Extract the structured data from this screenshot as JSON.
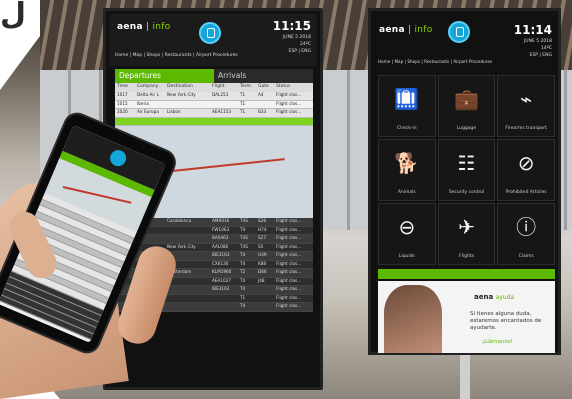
{
  "corner_glyph": "ل",
  "kiosk1": {
    "brand": "aena",
    "brand_sub": "info",
    "time": "11:15",
    "date": "JUNE 5 2018",
    "temp": "24ºC",
    "lang": "ESP | ENG",
    "nav": "Home | Map | Shops | Restaurants | Airport Procedures",
    "tabs": [
      "Departures",
      "Arrivals"
    ],
    "columns": [
      "Time",
      "Company",
      "Destination",
      "Flight",
      "Term.",
      "Gate",
      "Status"
    ],
    "rows_top": [
      [
        "1017",
        "Delta Air L",
        "New York City",
        "DAL253",
        "T1",
        "A4",
        "Flight clos..."
      ],
      [
        "1015",
        "Iberia",
        "",
        "",
        "T1",
        "",
        "Flight clos..."
      ],
      [
        "1020",
        "Air Europa",
        "Lisbon",
        "AEA1153",
        "T1",
        "B33",
        "Flight clos..."
      ]
    ],
    "rows_bottom": [
      [
        "",
        "",
        "Casablanca",
        "AMX016",
        "T4S",
        "S28",
        "Flight clos..."
      ],
      [
        "",
        "",
        "",
        "FW1063",
        "T4",
        "H74",
        "Flight clos..."
      ],
      [
        "",
        "",
        "",
        "BA0463",
        "T4S",
        "S27",
        "Flight clos..."
      ],
      [
        "",
        "",
        "New York City",
        "AAL086",
        "T4S",
        "S5",
        "Flight clos..."
      ],
      [
        "",
        "",
        "",
        "IBE3163",
        "T4",
        "H39",
        "Flight clos..."
      ],
      [
        "",
        "",
        "",
        "CX6130",
        "T4",
        "K88",
        "Flight clos..."
      ],
      [
        "",
        "",
        "Amsterdam",
        "KLM1960",
        "T2",
        "D66",
        "Flight clos..."
      ],
      [
        "",
        "",
        "",
        "AEA1027",
        "T4",
        "J48",
        "Flight clos..."
      ],
      [
        "",
        "",
        "",
        "IBE3162",
        "T4",
        "",
        "Flight clos..."
      ],
      [
        "",
        "",
        "",
        "",
        "T1",
        "",
        "Flight clos..."
      ],
      [
        "",
        "",
        "",
        "",
        "T4",
        "",
        "Flight clos..."
      ]
    ]
  },
  "kiosk2": {
    "brand": "aena",
    "brand_sub": "info",
    "time": "11:14",
    "date": "JUNE 5 2018",
    "temp": "14ºC",
    "lang": "ESP | ENG",
    "nav": "Home | Map | Shops | Restaurants | Airport Procedures",
    "tiles": [
      {
        "icon": "luggage-cart-icon",
        "glyph": "🛄",
        "label": "Check-in"
      },
      {
        "icon": "luggage-icon",
        "glyph": "💼",
        "label": "Luggage"
      },
      {
        "icon": "gun-icon",
        "glyph": "⌁",
        "label": "Firearms transport"
      },
      {
        "icon": "dog-icon",
        "glyph": "🐕",
        "label": "Animals"
      },
      {
        "icon": "security-control-icon",
        "glyph": "☷",
        "label": "Security control"
      },
      {
        "icon": "prohibited-articles-icon",
        "glyph": "⊘",
        "label": "Prohibited Articles"
      },
      {
        "icon": "liquids-icon",
        "glyph": "⊖",
        "label": "Liquids"
      },
      {
        "icon": "flights-icon",
        "glyph": "✈",
        "label": "Flights"
      },
      {
        "icon": "info-icon",
        "glyph": "ⓘ",
        "label": "Claims"
      }
    ],
    "promo": {
      "brand": "aena",
      "brand_sub": "ayuda",
      "text": "Si tienes alguna duda, estaremos encantados de ayudarte.",
      "cta": "¡Llámanos!"
    }
  },
  "colors": {
    "accent_green": "#5cb800",
    "badge_blue": "#14a6d9"
  }
}
